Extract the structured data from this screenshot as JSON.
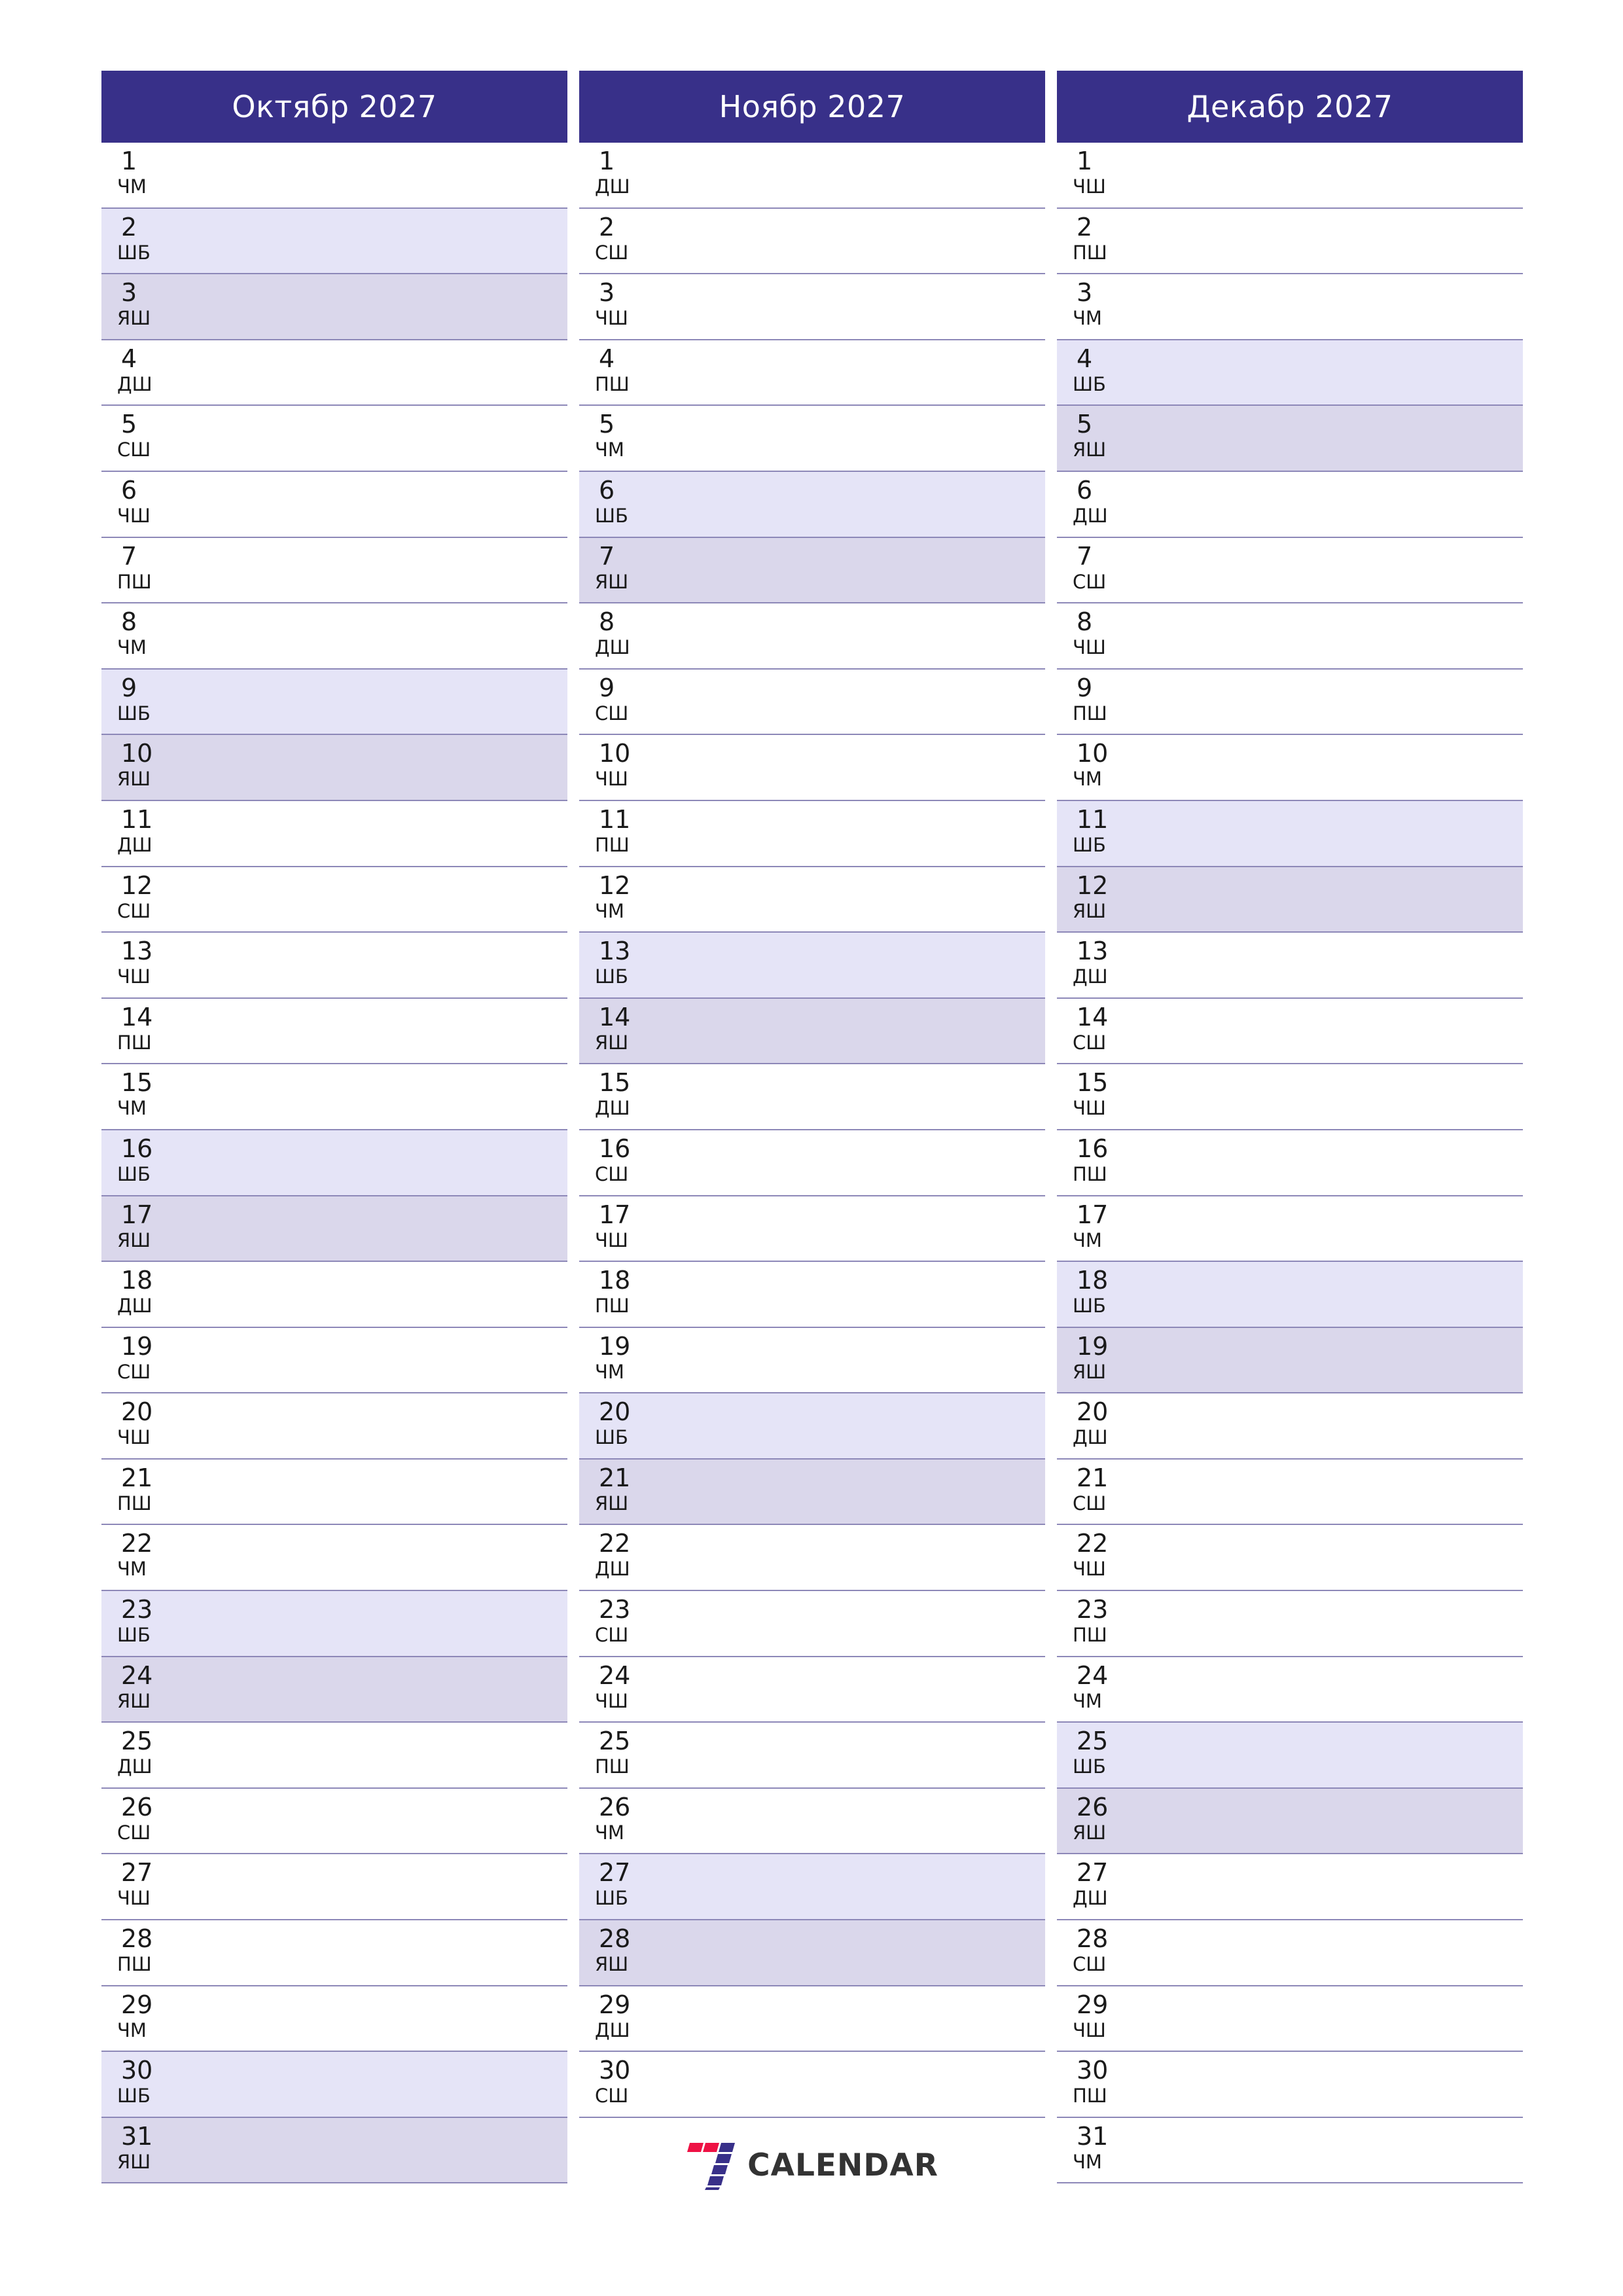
{
  "page": {
    "title": "Calendar planner October - December 2027",
    "background": "#ffffff",
    "header_bg": "#383089",
    "header_fg": "#ffffff",
    "saturday_bg": "#e5e4f7",
    "sunday_bg": "#dad7eb",
    "rule_color": "#8d88b8",
    "text_color": "#1a1a1a"
  },
  "weekday_abbrevs": {
    "friday": "ЧМ",
    "saturday": "ШБ",
    "sunday": "ЯШ",
    "monday": "ДШ",
    "tuesday": "СШ",
    "wednesday": "ЧШ",
    "thursday": "ПШ"
  },
  "logo": {
    "name": "7calendar-logo",
    "word": "CALENDAR",
    "mark": "seven-stripes",
    "red": "#ee1144",
    "purple": "#383089",
    "word_color": "#333333"
  },
  "months": [
    {
      "name": "october",
      "title": "Октябр 2027",
      "days": [
        {
          "n": "1",
          "w": "ЧМ",
          "t": "fri"
        },
        {
          "n": "2",
          "w": "ШБ",
          "t": "sat"
        },
        {
          "n": "3",
          "w": "ЯШ",
          "t": "sun"
        },
        {
          "n": "4",
          "w": "ДШ",
          "t": "mon"
        },
        {
          "n": "5",
          "w": "СШ",
          "t": "tue"
        },
        {
          "n": "6",
          "w": "ЧШ",
          "t": "wed"
        },
        {
          "n": "7",
          "w": "ПШ",
          "t": "thu"
        },
        {
          "n": "8",
          "w": "ЧМ",
          "t": "fri"
        },
        {
          "n": "9",
          "w": "ШБ",
          "t": "sat"
        },
        {
          "n": "10",
          "w": "ЯШ",
          "t": "sun"
        },
        {
          "n": "11",
          "w": "ДШ",
          "t": "mon"
        },
        {
          "n": "12",
          "w": "СШ",
          "t": "tue"
        },
        {
          "n": "13",
          "w": "ЧШ",
          "t": "wed"
        },
        {
          "n": "14",
          "w": "ПШ",
          "t": "thu"
        },
        {
          "n": "15",
          "w": "ЧМ",
          "t": "fri"
        },
        {
          "n": "16",
          "w": "ШБ",
          "t": "sat"
        },
        {
          "n": "17",
          "w": "ЯШ",
          "t": "sun"
        },
        {
          "n": "18",
          "w": "ДШ",
          "t": "mon"
        },
        {
          "n": "19",
          "w": "СШ",
          "t": "tue"
        },
        {
          "n": "20",
          "w": "ЧШ",
          "t": "wed"
        },
        {
          "n": "21",
          "w": "ПШ",
          "t": "thu"
        },
        {
          "n": "22",
          "w": "ЧМ",
          "t": "fri"
        },
        {
          "n": "23",
          "w": "ШБ",
          "t": "sat"
        },
        {
          "n": "24",
          "w": "ЯШ",
          "t": "sun"
        },
        {
          "n": "25",
          "w": "ДШ",
          "t": "mon"
        },
        {
          "n": "26",
          "w": "СШ",
          "t": "tue"
        },
        {
          "n": "27",
          "w": "ЧШ",
          "t": "wed"
        },
        {
          "n": "28",
          "w": "ПШ",
          "t": "thu"
        },
        {
          "n": "29",
          "w": "ЧМ",
          "t": "fri"
        },
        {
          "n": "30",
          "w": "ШБ",
          "t": "sat"
        },
        {
          "n": "31",
          "w": "ЯШ",
          "t": "sun"
        }
      ],
      "has_logo": false
    },
    {
      "name": "november",
      "title": "Ноябр 2027",
      "days": [
        {
          "n": "1",
          "w": "ДШ",
          "t": "mon"
        },
        {
          "n": "2",
          "w": "СШ",
          "t": "tue"
        },
        {
          "n": "3",
          "w": "ЧШ",
          "t": "wed"
        },
        {
          "n": "4",
          "w": "ПШ",
          "t": "thu"
        },
        {
          "n": "5",
          "w": "ЧМ",
          "t": "fri"
        },
        {
          "n": "6",
          "w": "ШБ",
          "t": "sat"
        },
        {
          "n": "7",
          "w": "ЯШ",
          "t": "sun"
        },
        {
          "n": "8",
          "w": "ДШ",
          "t": "mon"
        },
        {
          "n": "9",
          "w": "СШ",
          "t": "tue"
        },
        {
          "n": "10",
          "w": "ЧШ",
          "t": "wed"
        },
        {
          "n": "11",
          "w": "ПШ",
          "t": "thu"
        },
        {
          "n": "12",
          "w": "ЧМ",
          "t": "fri"
        },
        {
          "n": "13",
          "w": "ШБ",
          "t": "sat"
        },
        {
          "n": "14",
          "w": "ЯШ",
          "t": "sun"
        },
        {
          "n": "15",
          "w": "ДШ",
          "t": "mon"
        },
        {
          "n": "16",
          "w": "СШ",
          "t": "tue"
        },
        {
          "n": "17",
          "w": "ЧШ",
          "t": "wed"
        },
        {
          "n": "18",
          "w": "ПШ",
          "t": "thu"
        },
        {
          "n": "19",
          "w": "ЧМ",
          "t": "fri"
        },
        {
          "n": "20",
          "w": "ШБ",
          "t": "sat"
        },
        {
          "n": "21",
          "w": "ЯШ",
          "t": "sun"
        },
        {
          "n": "22",
          "w": "ДШ",
          "t": "mon"
        },
        {
          "n": "23",
          "w": "СШ",
          "t": "tue"
        },
        {
          "n": "24",
          "w": "ЧШ",
          "t": "wed"
        },
        {
          "n": "25",
          "w": "ПШ",
          "t": "thu"
        },
        {
          "n": "26",
          "w": "ЧМ",
          "t": "fri"
        },
        {
          "n": "27",
          "w": "ШБ",
          "t": "sat"
        },
        {
          "n": "28",
          "w": "ЯШ",
          "t": "sun"
        },
        {
          "n": "29",
          "w": "ДШ",
          "t": "mon"
        },
        {
          "n": "30",
          "w": "СШ",
          "t": "tue"
        }
      ],
      "has_logo": true
    },
    {
      "name": "december",
      "title": "Декабр 2027",
      "days": [
        {
          "n": "1",
          "w": "ЧШ",
          "t": "wed"
        },
        {
          "n": "2",
          "w": "ПШ",
          "t": "thu"
        },
        {
          "n": "3",
          "w": "ЧМ",
          "t": "fri"
        },
        {
          "n": "4",
          "w": "ШБ",
          "t": "sat"
        },
        {
          "n": "5",
          "w": "ЯШ",
          "t": "sun"
        },
        {
          "n": "6",
          "w": "ДШ",
          "t": "mon"
        },
        {
          "n": "7",
          "w": "СШ",
          "t": "tue"
        },
        {
          "n": "8",
          "w": "ЧШ",
          "t": "wed"
        },
        {
          "n": "9",
          "w": "ПШ",
          "t": "thu"
        },
        {
          "n": "10",
          "w": "ЧМ",
          "t": "fri"
        },
        {
          "n": "11",
          "w": "ШБ",
          "t": "sat"
        },
        {
          "n": "12",
          "w": "ЯШ",
          "t": "sun"
        },
        {
          "n": "13",
          "w": "ДШ",
          "t": "mon"
        },
        {
          "n": "14",
          "w": "СШ",
          "t": "tue"
        },
        {
          "n": "15",
          "w": "ЧШ",
          "t": "wed"
        },
        {
          "n": "16",
          "w": "ПШ",
          "t": "thu"
        },
        {
          "n": "17",
          "w": "ЧМ",
          "t": "fri"
        },
        {
          "n": "18",
          "w": "ШБ",
          "t": "sat"
        },
        {
          "n": "19",
          "w": "ЯШ",
          "t": "sun"
        },
        {
          "n": "20",
          "w": "ДШ",
          "t": "mon"
        },
        {
          "n": "21",
          "w": "СШ",
          "t": "tue"
        },
        {
          "n": "22",
          "w": "ЧШ",
          "t": "wed"
        },
        {
          "n": "23",
          "w": "ПШ",
          "t": "thu"
        },
        {
          "n": "24",
          "w": "ЧМ",
          "t": "fri"
        },
        {
          "n": "25",
          "w": "ШБ",
          "t": "sat"
        },
        {
          "n": "26",
          "w": "ЯШ",
          "t": "sun"
        },
        {
          "n": "27",
          "w": "ДШ",
          "t": "mon"
        },
        {
          "n": "28",
          "w": "СШ",
          "t": "tue"
        },
        {
          "n": "29",
          "w": "ЧШ",
          "t": "wed"
        },
        {
          "n": "30",
          "w": "ПШ",
          "t": "thu"
        },
        {
          "n": "31",
          "w": "ЧМ",
          "t": "fri"
        }
      ],
      "has_logo": false
    }
  ]
}
